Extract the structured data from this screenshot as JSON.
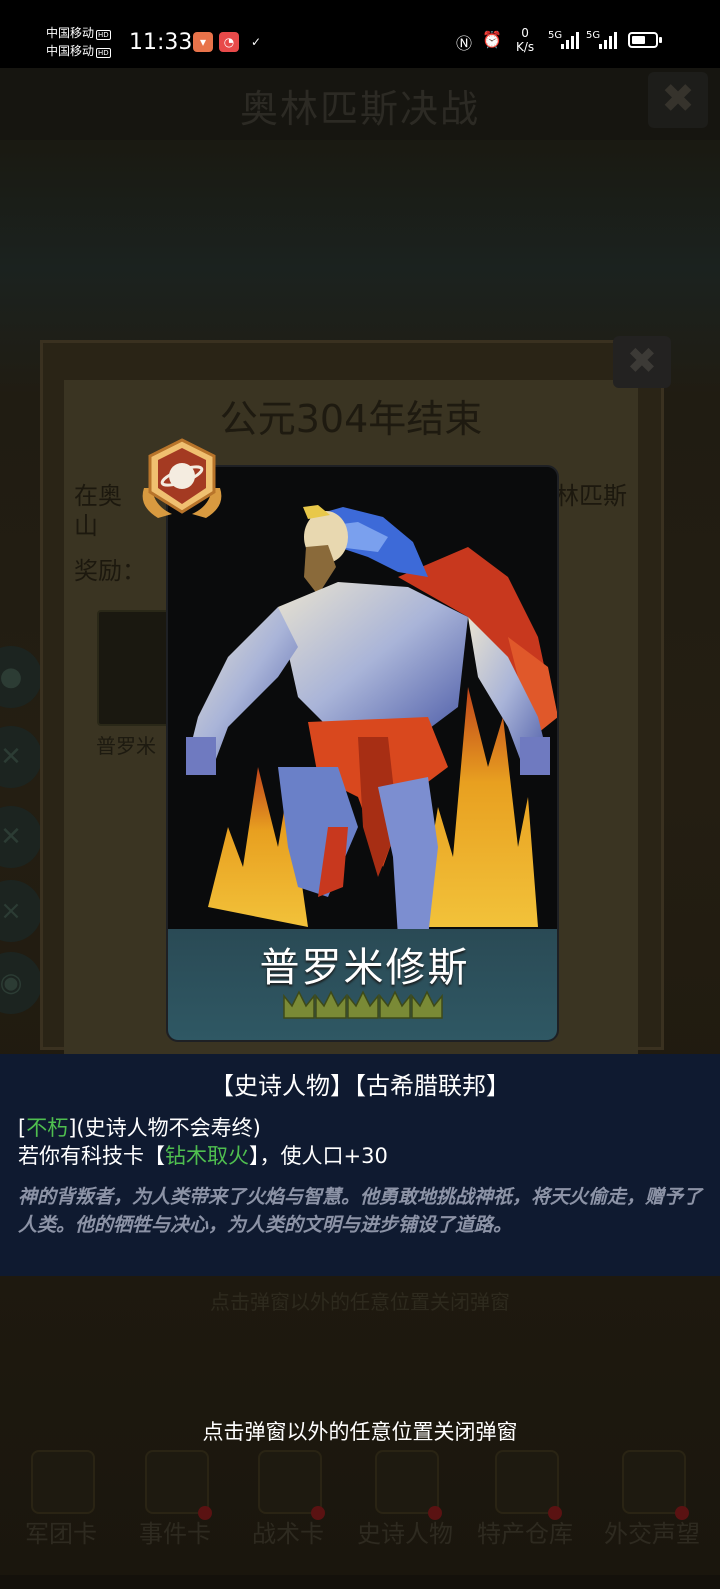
{
  "status_bar": {
    "carrier1": "中国移动",
    "carrier2": "中国移动",
    "hd": "HD",
    "time": "11:33",
    "net_speed_value": "0",
    "net_speed_unit": "K/s",
    "signal1": "5G",
    "signal2": "5G",
    "battery_level": 0.6,
    "icons": [
      "app-icon-orange",
      "app-icon-red",
      "app-icon-check",
      "nfc-icon",
      "alarm-icon"
    ]
  },
  "background_screen": {
    "title": "奥林匹斯决战",
    "close_glyph": "✖"
  },
  "event_panel": {
    "title": "公元304年结束",
    "line1_left": "在奥",
    "line1_right": "林匹斯",
    "line2": "山",
    "reward_label": "奖励：",
    "small_card_label": "普罗米"
  },
  "card": {
    "name": "普罗米修斯",
    "crowns": 5,
    "badge_icon": "planet-laurel-badge-icon"
  },
  "info_box": {
    "tags": "【史诗人物】【古希腊联邦】",
    "line1_bracket_open": "[",
    "line1_keyword": "不朽",
    "line1_rest": "](史诗人物不会寿终)",
    "line2_prefix": "若你有科技卡【",
    "line2_keyword": "钻木取火",
    "line2_suffix": "】，使人口+30",
    "description": "神的背叛者，为人类带来了火焰与智慧。他勇敢地挑战神祇，将天火偷走，赠予了人类。他的牺牲与决心，为人类的文明与进步铺设了道路。"
  },
  "hint_background": "点击弹窗以外的任意位置关闭弹窗",
  "hint": "点击弹窗以外的任意位置关闭弹窗",
  "bottom_nav": {
    "items": [
      {
        "label": "军团卡"
      },
      {
        "label": "事件卡"
      },
      {
        "label": "战术卡"
      },
      {
        "label": "史诗人物"
      },
      {
        "label": "特产仓库"
      },
      {
        "label": "外交声望"
      }
    ]
  },
  "colors": {
    "keyword_green": "#4fbf4f",
    "info_bg": "#0f1a30",
    "description_grey": "#8c93a6"
  }
}
